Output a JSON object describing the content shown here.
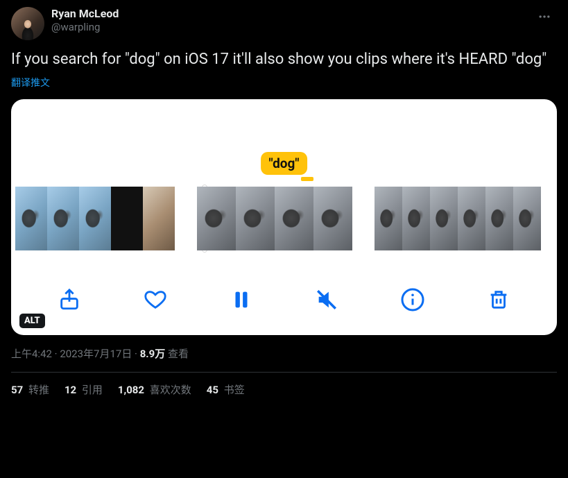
{
  "author": {
    "display_name": "Ryan McLeod",
    "handle": "@warpling"
  },
  "tweet_text": "If you search for \"dog\" on iOS 17 it'll also show you clips where it's HEARD \"dog\"",
  "translate_label": "翻译推文",
  "media": {
    "dog_tag": "\"dog\"",
    "alt_badge": "ALT"
  },
  "meta": {
    "time": "上午4:42",
    "sep": " · ",
    "date": "2023年7月17日",
    "views_count": "8.9万",
    "views_label": " 查看"
  },
  "stats": {
    "retweets": {
      "count": "57",
      "label": " 转推"
    },
    "quotes": {
      "count": "12",
      "label": " 引用"
    },
    "likes": {
      "count": "1,082",
      "label": " 喜欢次数"
    },
    "bookmarks": {
      "count": "45",
      "label": " 书签"
    }
  }
}
